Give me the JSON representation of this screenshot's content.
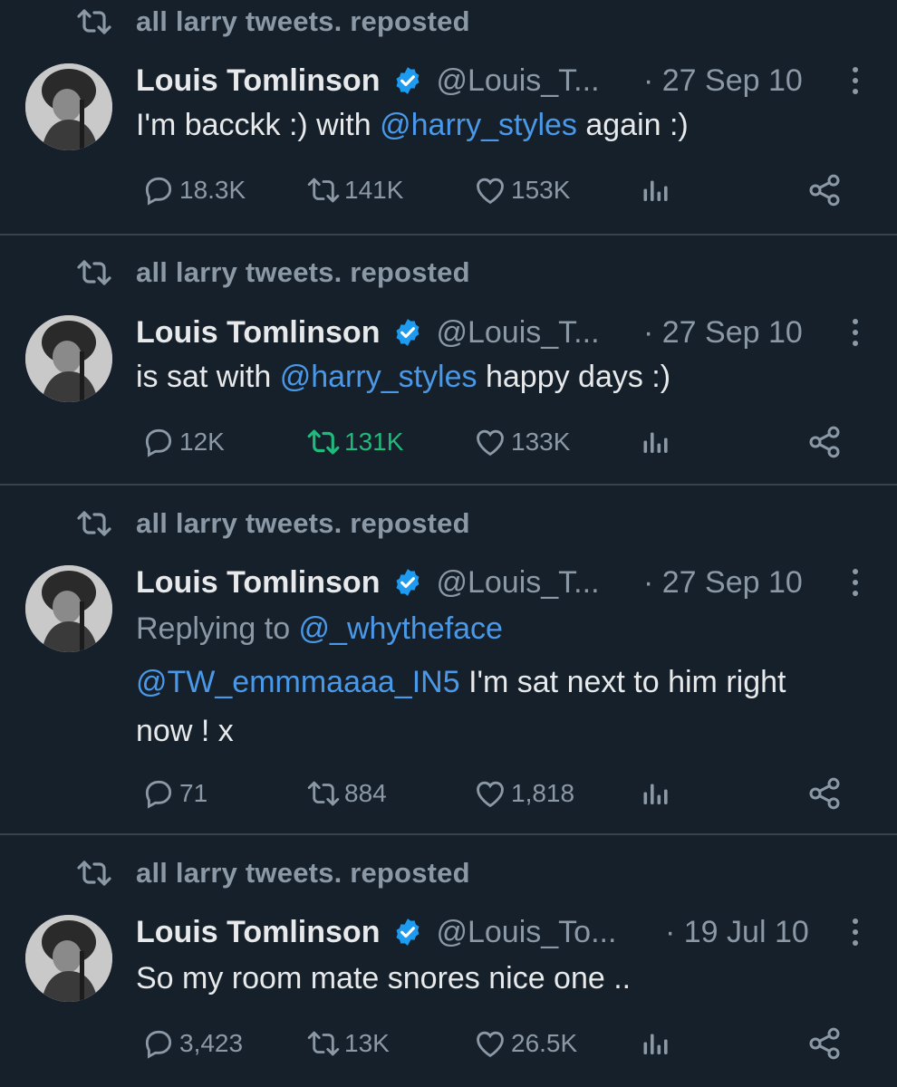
{
  "colors": {
    "background": "#15202b",
    "text": "#e7e9ea",
    "muted": "#8b98a5",
    "mention": "#4a99e9",
    "verified": "#1d9bf0",
    "retweeted": "#20ba7c",
    "divider": "#38444d"
  },
  "tweets": [
    {
      "repost_label": "all larry tweets. reposted",
      "name": "Louis Tomlinson",
      "handle": "@Louis_T...",
      "date": "· 27 Sep 10",
      "body": {
        "t1": "I'm bacckk :) with ",
        "m1": "@harry_styles",
        "t2": " again :)"
      },
      "stats": {
        "replies": "18.3K",
        "reposts": "141K",
        "likes": "153K"
      },
      "reposted_by_viewer": false
    },
    {
      "repost_label": "all larry tweets. reposted",
      "name": "Louis Tomlinson",
      "handle": "@Louis_T...",
      "date": "· 27 Sep 10",
      "body": {
        "t1": "is sat with ",
        "m1": "@harry_styles",
        "t2": " happy days :)"
      },
      "stats": {
        "replies": "12K",
        "reposts": "131K",
        "likes": "133K"
      },
      "reposted_by_viewer": true
    },
    {
      "repost_label": "all larry tweets. reposted",
      "name": "Louis Tomlinson",
      "handle": "@Louis_T...",
      "date": "· 27 Sep 10",
      "replying": {
        "prefix": "Replying to ",
        "mention": "@_whytheface"
      },
      "body": {
        "m1": "@TW_emmmaaaa_IN5",
        "t1": " I'm sat next to him right",
        "t2": "now ! x"
      },
      "stats": {
        "replies": "71",
        "reposts": "884",
        "likes": "1,818"
      },
      "reposted_by_viewer": false
    },
    {
      "repost_label": "all larry tweets. reposted",
      "name": "Louis Tomlinson",
      "handle": "@Louis_To...",
      "date": "· 19 Jul 10",
      "body": {
        "t1": "So my room mate snores nice one .."
      },
      "stats": {
        "replies": "3,423",
        "reposts": "13K",
        "likes": "26.5K"
      },
      "reposted_by_viewer": false
    }
  ],
  "icons": {
    "repost": "repost-icon",
    "verified": "verified-badge-icon",
    "more": "more-options-icon",
    "reply": "reply-icon",
    "like": "like-icon",
    "views": "views-icon",
    "share": "share-icon"
  }
}
